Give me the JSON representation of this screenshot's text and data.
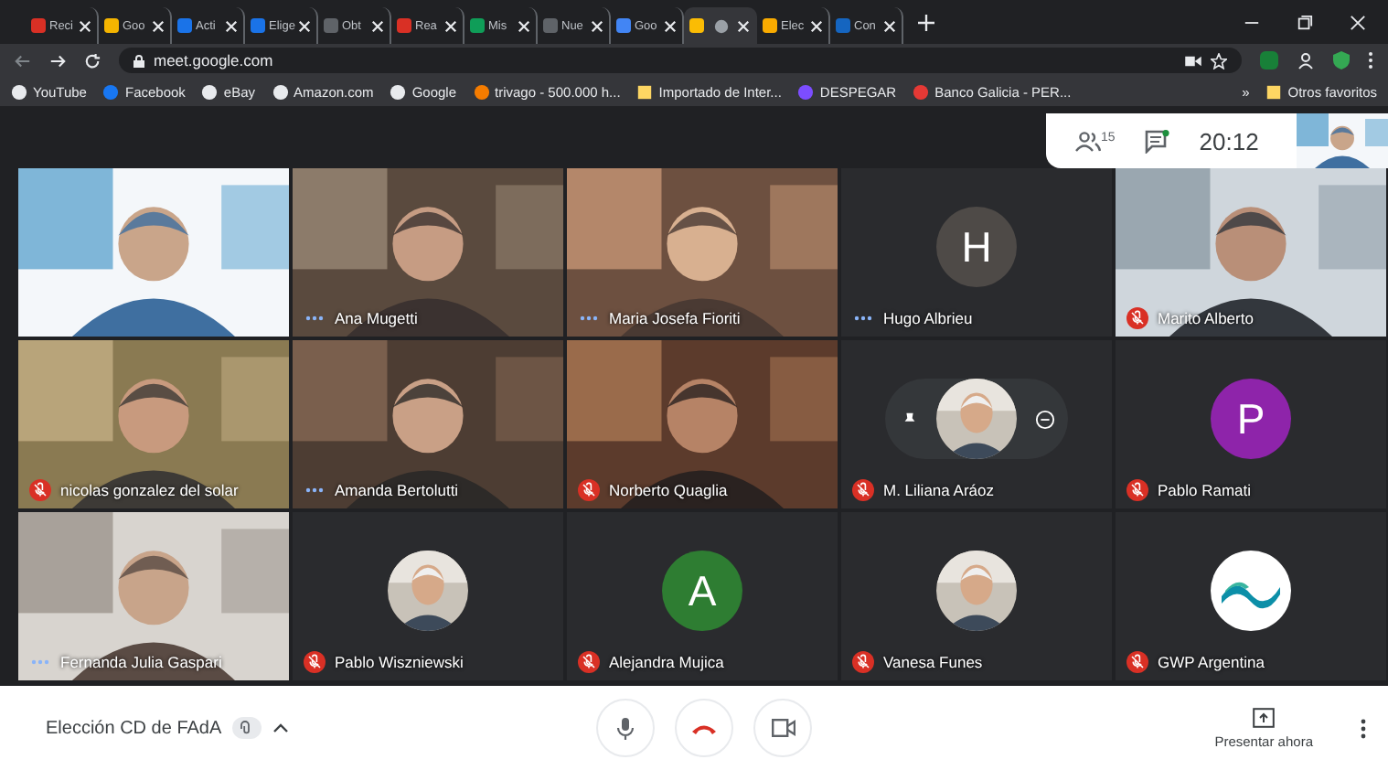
{
  "browser": {
    "tabs": [
      {
        "label": "Reci",
        "selected": false
      },
      {
        "label": "Goo",
        "selected": false
      },
      {
        "label": "Acti",
        "selected": false
      },
      {
        "label": "Elige",
        "selected": false
      },
      {
        "label": "Obt",
        "selected": false
      },
      {
        "label": "Rea",
        "selected": false
      },
      {
        "label": "Mis",
        "selected": false
      },
      {
        "label": "Nue",
        "selected": false
      },
      {
        "label": "Goo",
        "selected": false
      },
      {
        "selected": true
      },
      {
        "label": "Elec",
        "selected": false
      },
      {
        "label": "Con",
        "selected": false
      }
    ],
    "address": "meet.google.com",
    "bookmarks": [
      {
        "kind": "site",
        "label": "YouTube"
      },
      {
        "kind": "site",
        "label": "Facebook"
      },
      {
        "kind": "site",
        "label": "eBay"
      },
      {
        "kind": "site",
        "label": "Amazon.com"
      },
      {
        "kind": "site",
        "label": "Google"
      },
      {
        "kind": "site",
        "label": "trivago - 500.000 h..."
      },
      {
        "kind": "folder",
        "label": "Importado de Inter..."
      },
      {
        "kind": "site",
        "label": "DESPEGAR"
      },
      {
        "kind": "site",
        "label": "Banco Galicia - PER..."
      }
    ],
    "bookmarks_overflow": "»",
    "other_bookmarks": "Otros favoritos"
  },
  "meet": {
    "participants_count": "15",
    "time": "20:12",
    "tiles": [
      {
        "kind": "video"
      },
      {
        "kind": "video",
        "name": "Ana Mugetti",
        "muted": false
      },
      {
        "kind": "video",
        "name": "Maria Josefa Fioriti",
        "muted": false
      },
      {
        "kind": "letter",
        "letter": "H",
        "color": "#4e4a47",
        "name": "Hugo Albrieu",
        "muted": false
      },
      {
        "kind": "video",
        "name": "Marito Alberto",
        "muted": true
      },
      {
        "kind": "video",
        "name": "nicolas gonzalez del solar",
        "muted": true
      },
      {
        "kind": "video",
        "name": "Amanda Bertolutti",
        "muted": false
      },
      {
        "kind": "video",
        "name": "Norberto Quaglia",
        "muted": true
      },
      {
        "name": "M. Liliana Aráoz",
        "muted": true,
        "controls_shown": true
      },
      {
        "kind": "letter",
        "letter": "P",
        "color": "#8e24aa",
        "name": "Pablo Ramati",
        "muted": true
      },
      {
        "kind": "video",
        "name": "Fernanda Julia Gaspari",
        "muted": false
      },
      {
        "name": "Pablo Wiszniewski",
        "muted": true
      },
      {
        "kind": "letter",
        "letter": "A",
        "color": "#2e7d32",
        "name": "Alejandra Mujica",
        "muted": true
      },
      {
        "name": "Vanesa Funes",
        "muted": true
      },
      {
        "kind": "logo",
        "name": "GWP Argentina",
        "muted": true
      }
    ],
    "meeting_title": "Elección CD de FAdA",
    "present_label": "Presentar ahora"
  }
}
